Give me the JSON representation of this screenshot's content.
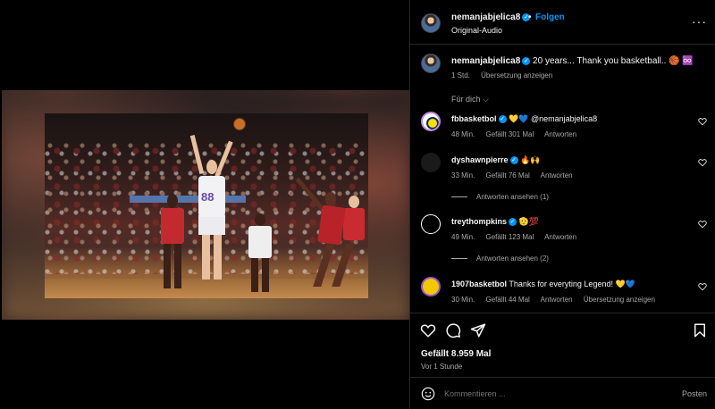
{
  "post": {
    "username": "nemanjabjelica8",
    "audio": "Original-Audio",
    "follow_label": "Folgen",
    "dot": "•",
    "more": "···"
  },
  "media": {
    "jersey_number": "88"
  },
  "caption": {
    "username": "nemanjabjelica8",
    "text": "20 years... Thank you basketball.. 🏀 ♾️",
    "time": "1 Std.",
    "translate": "Übersetzung anzeigen"
  },
  "filter": {
    "label": "Für dich ⌵"
  },
  "comments": [
    {
      "username": "fbbasketbol",
      "text": "💛💙 @nemanjabjelica8",
      "time": "48 Min.",
      "likes": "Gefällt 301 Mal",
      "reply": "Antworten"
    },
    {
      "username": "dyshawnpierre",
      "text": "🔥🙌",
      "time": "33 Min.",
      "likes": "Gefällt 76 Mal",
      "reply": "Antworten",
      "view_replies": "Antworten ansehen (1)"
    },
    {
      "username": "treythompkins",
      "text": "🫡💯",
      "time": "49 Min.",
      "likes": "Gefällt 123 Mal",
      "reply": "Antworten",
      "view_replies": "Antworten ansehen (2)"
    },
    {
      "username": "1907basketbol",
      "text": "Thanks for everyting Legend! 💛💙",
      "time": "30 Min.",
      "likes": "Gefällt 44 Mal",
      "reply": "Antworten",
      "translate": "Übersetzung anzeigen"
    }
  ],
  "actions": {
    "likes": "Gefällt 8.959 Mal",
    "time": "Vor 1 Stunde"
  },
  "comment_box": {
    "placeholder": "Kommentieren ...",
    "post_label": "Posten"
  },
  "colors": {
    "accent": "#0095f6",
    "background": "#000000",
    "secondary_text": "#a8a8a8"
  }
}
